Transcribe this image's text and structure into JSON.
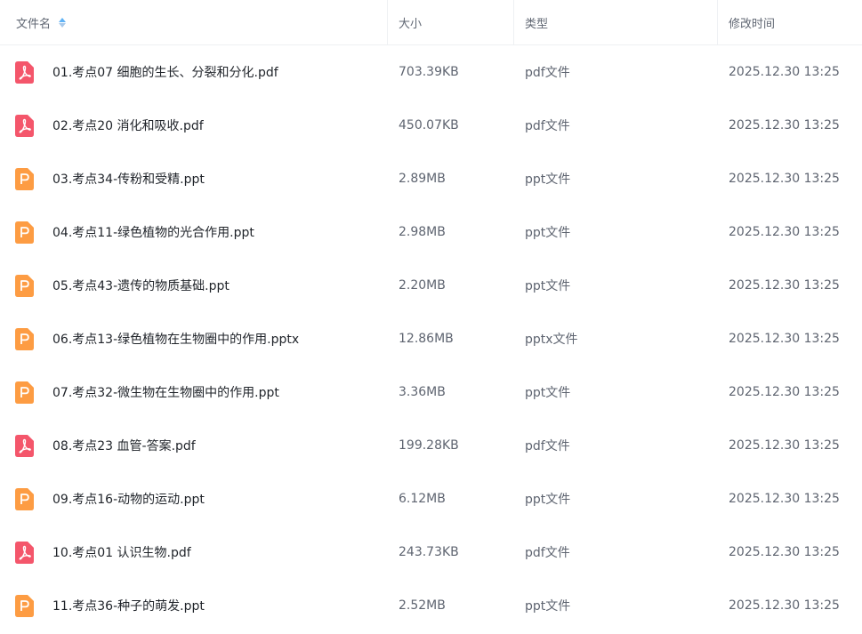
{
  "colors": {
    "pdf_icon": "#f4566b",
    "ppt_icon": "#fd9c43",
    "sort_active": "#5fb2f6"
  },
  "columns": {
    "name": "文件名",
    "size": "大小",
    "type": "类型",
    "modified": "修改时间"
  },
  "files": [
    {
      "icon": "pdf-icon",
      "name": "01.考点07 细胞的生长、分裂和分化.pdf",
      "size": "703.39KB",
      "type": "pdf文件",
      "modified": "2025.12.30 13:25"
    },
    {
      "icon": "pdf-icon",
      "name": "02.考点20 消化和吸收.pdf",
      "size": "450.07KB",
      "type": "pdf文件",
      "modified": "2025.12.30 13:25"
    },
    {
      "icon": "ppt-icon",
      "name": "03.考点34-传粉和受精.ppt",
      "size": "2.89MB",
      "type": "ppt文件",
      "modified": "2025.12.30 13:25"
    },
    {
      "icon": "ppt-icon",
      "name": "04.考点11-绿色植物的光合作用.ppt",
      "size": "2.98MB",
      "type": "ppt文件",
      "modified": "2025.12.30 13:25"
    },
    {
      "icon": "ppt-icon",
      "name": "05.考点43-遗传的物质基础.ppt",
      "size": "2.20MB",
      "type": "ppt文件",
      "modified": "2025.12.30 13:25"
    },
    {
      "icon": "ppt-icon",
      "name": "06.考点13-绿色植物在生物圈中的作用.pptx",
      "size": "12.86MB",
      "type": "pptx文件",
      "modified": "2025.12.30 13:25"
    },
    {
      "icon": "ppt-icon",
      "name": "07.考点32-微生物在生物圈中的作用.ppt",
      "size": "3.36MB",
      "type": "ppt文件",
      "modified": "2025.12.30 13:25"
    },
    {
      "icon": "pdf-icon",
      "name": "08.考点23 血管-答案.pdf",
      "size": "199.28KB",
      "type": "pdf文件",
      "modified": "2025.12.30 13:25"
    },
    {
      "icon": "ppt-icon",
      "name": "09.考点16-动物的运动.ppt",
      "size": "6.12MB",
      "type": "ppt文件",
      "modified": "2025.12.30 13:25"
    },
    {
      "icon": "pdf-icon",
      "name": "10.考点01 认识生物.pdf",
      "size": "243.73KB",
      "type": "pdf文件",
      "modified": "2025.12.30 13:25"
    },
    {
      "icon": "ppt-icon",
      "name": "11.考点36-种子的萌发.ppt",
      "size": "2.52MB",
      "type": "ppt文件",
      "modified": "2025.12.30 13:25"
    }
  ]
}
